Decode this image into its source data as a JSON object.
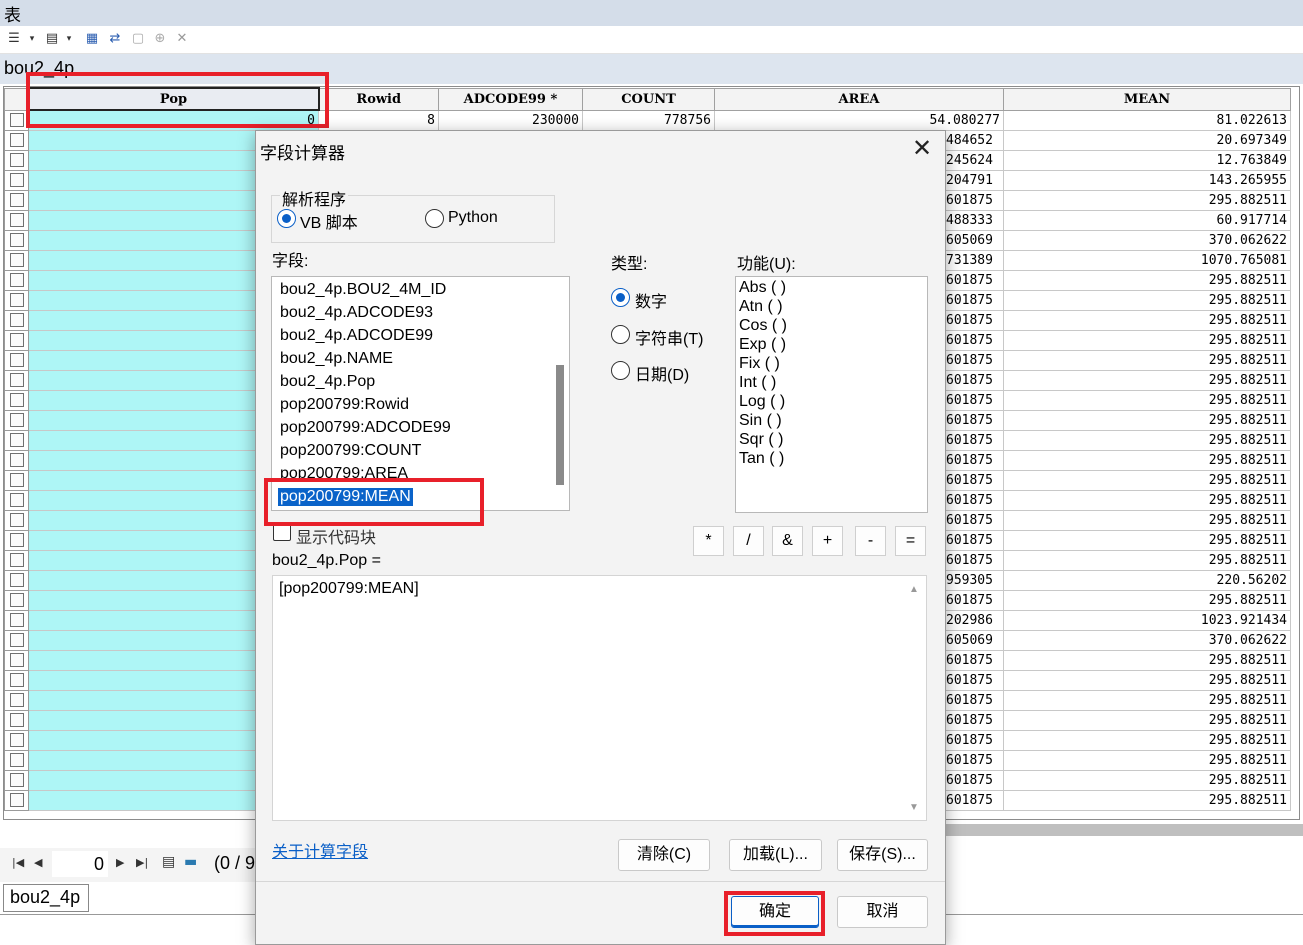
{
  "window": {
    "title": "表"
  },
  "toolbar": {
    "icons": [
      "table-options-icon",
      "related-tables-icon",
      "select-by-attributes-icon",
      "switch-selection-icon",
      "clear-selection-icon",
      "zoom-to-selected-icon",
      "delete-selected-icon"
    ]
  },
  "table": {
    "name": "bou2_4p",
    "columns": [
      "Pop",
      "Rowid",
      "ADCODE99 *",
      "COUNT",
      "AREA",
      "MEAN"
    ],
    "first_row": {
      "Pop": "0",
      "Rowid": "8",
      "ADCODE99": "230000",
      "COUNT": "778756",
      "AREA": "54.080277",
      "MEAN": "81.022613"
    },
    "area_partial": [
      "484652",
      "245624",
      "204791",
      "601875",
      "488333",
      "605069",
      "731389",
      "601875",
      "601875",
      "601875",
      "601875",
      "601875",
      "601875",
      "601875",
      "601875",
      "601875",
      "601875",
      "601875",
      "601875",
      "601875",
      "601875",
      "601875",
      "959305",
      "601875",
      "202986",
      "605069",
      "601875",
      "601875",
      "601875",
      "601875",
      "601875",
      "601875",
      "601875"
    ],
    "mean_values": [
      "20.697349",
      "12.763849",
      "143.265955",
      "295.882511",
      "60.917714",
      "370.062622",
      "1070.765081",
      "295.882511",
      "295.882511",
      "295.882511",
      "295.882511",
      "295.882511",
      "295.882511",
      "295.882511",
      "295.882511",
      "295.882511",
      "295.882511",
      "295.882511",
      "295.882511",
      "295.882511",
      "295.882511",
      "295.882511",
      "220.56202",
      "295.882511",
      "1023.921434",
      "370.062622",
      "295.882511",
      "295.882511",
      "295.882511",
      "295.882511",
      "295.882511",
      "295.882511",
      "295.882511"
    ],
    "cutoff_row": {
      "AREA": "601875",
      "MEAN": "295.882511"
    }
  },
  "navigation": {
    "current": "0",
    "count_text": "(0 / 9"
  },
  "bottom_tab": "bou2_4p",
  "dialog": {
    "title": "字段计算器",
    "parser_label": "解析程序",
    "parser_options": [
      "VB 脚本",
      "Python"
    ],
    "parser_selected": "VB 脚本",
    "fields_label": "字段:",
    "fields": [
      "bou2_4p.BOU2_4M_ID",
      "bou2_4p.ADCODE93",
      "bou2_4p.ADCODE99",
      "bou2_4p.NAME",
      "bou2_4p.Pop",
      "pop200799:Rowid",
      "pop200799:ADCODE99",
      "pop200799:COUNT",
      "pop200799:AREA",
      "pop200799:MEAN"
    ],
    "selected_field": "pop200799:MEAN",
    "type_label": "类型:",
    "types": [
      "数字",
      "字符串(T)",
      "日期(D)"
    ],
    "type_selected": "数字",
    "functions_label": "功能(U):",
    "functions": [
      "Abs ( )",
      "Atn ( )",
      "Cos ( )",
      "Exp ( )",
      "Fix ( )",
      "Int ( )",
      "Log ( )",
      "Sin ( )",
      "Sqr ( )",
      "Tan ( )"
    ],
    "show_codeblock_label": "显示代码块",
    "operators": [
      "*",
      "/",
      "&",
      "+",
      "-",
      "="
    ],
    "expression_label": "bou2_4p.Pop =",
    "expression": "[pop200799:MEAN]",
    "about_link": "关于计算字段",
    "buttons": {
      "clear": "清除(C)",
      "load": "加载(L)...",
      "save": "保存(S)...",
      "ok": "确定",
      "cancel": "取消"
    }
  }
}
